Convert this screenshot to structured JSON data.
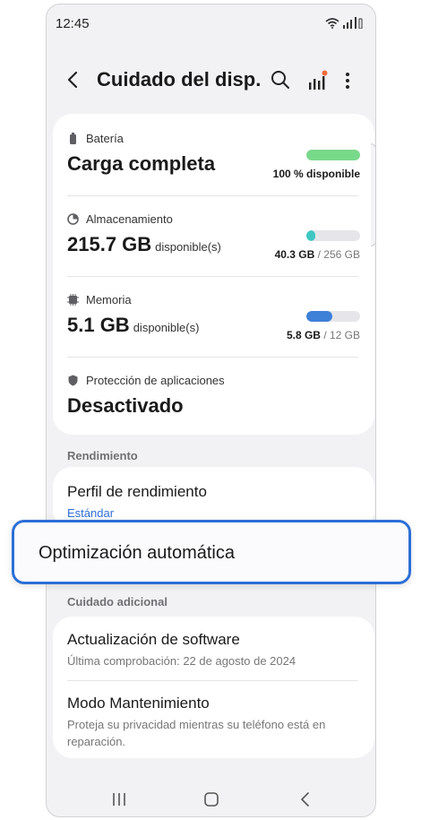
{
  "status_bar": {
    "time": "12:45"
  },
  "app_bar": {
    "title": "Cuidado del disp..."
  },
  "accent_color": "#2f6fd8",
  "sections": {
    "battery": {
      "label": "Batería",
      "value": "Carga completa",
      "level_percent": 100,
      "caption": "100 % disponible",
      "bar_color": "#79d98a"
    },
    "storage": {
      "label": "Almacenamiento",
      "value": "215.7 GB",
      "unit": "disponible(s)",
      "used": "40.3 GB",
      "total": "/ 256 GB",
      "used_fraction": 0.16,
      "bar_color": "#3fc8c2"
    },
    "memory": {
      "label": "Memoria",
      "value": "5.1 GB",
      "unit": "disponible(s)",
      "used": "5.8 GB",
      "total": "/ 12 GB",
      "used_fraction": 0.48,
      "bar_color": "#3e7fd8"
    },
    "app_protection": {
      "label": "Protección de aplicaciones",
      "value": "Desactivado"
    }
  },
  "performance": {
    "header": "Rendimiento",
    "profile_title": "Perfil de rendimiento",
    "profile_value": "Estándar",
    "auto_optimization": "Optimización automática"
  },
  "extra_care": {
    "header": "Cuidado adicional",
    "software_update_title": "Actualización de software",
    "software_update_sub": "Última comprobación: 22 de agosto de 2024",
    "maintenance_title": "Modo Mantenimiento",
    "maintenance_sub": "Proteja su privacidad mientras su teléfono está en reparación."
  },
  "icons": [
    "wifi-icon",
    "signal-icon",
    "back-icon",
    "search-icon",
    "report-icon",
    "more-icon",
    "battery-icon",
    "storage-icon",
    "memory-icon",
    "shield-icon",
    "recents-icon",
    "home-icon",
    "nav-back-icon"
  ]
}
